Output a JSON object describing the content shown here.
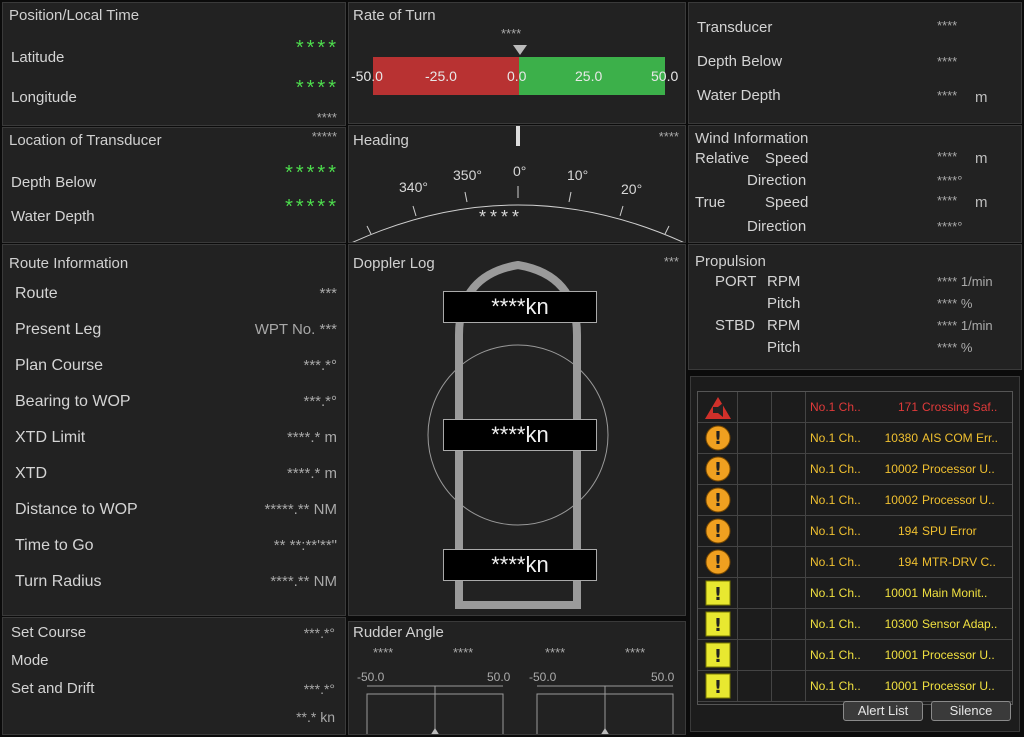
{
  "position": {
    "title": "Position/Local Time",
    "lat_label": "Latitude",
    "lat_value": "****",
    "lon_label": "Longitude",
    "lon_value": "****",
    "time_value": "****"
  },
  "transducer_loc": {
    "title": "Location of Transducer",
    "title_value": "*****",
    "depth_below_label": "Depth Below",
    "depth_below_value": "*****",
    "water_depth_label": "Water Depth",
    "water_depth_value": "*****"
  },
  "rate_of_turn": {
    "title": "Rate of Turn",
    "value": "****",
    "scale": [
      "-50.0",
      "-25.0",
      "0.0",
      "25.0",
      "50.0"
    ]
  },
  "heading": {
    "title": "Heading",
    "value_top": "****",
    "value_center": "****",
    "scale": [
      "340°",
      "350°",
      "0°",
      "10°",
      "20°"
    ]
  },
  "transducer": {
    "title": "Transducer",
    "title_value": "****",
    "depth_below_label": "Depth Below",
    "depth_below_value": "****",
    "water_depth_label": "Water Depth",
    "water_depth_value": "****",
    "water_depth_unit": "m"
  },
  "wind": {
    "title": "Wind Information",
    "relative_label": "Relative",
    "true_label": "True",
    "speed_label": "Speed",
    "direction_label": "Direction",
    "rel_speed": "****",
    "rel_speed_unit": "m",
    "rel_dir": "****°",
    "true_speed": "****",
    "true_speed_unit": "m",
    "true_dir": "****°"
  },
  "route": {
    "title": "Route Information",
    "rows": [
      {
        "label": "Route",
        "value": "***"
      },
      {
        "label": "Present Leg",
        "value": "WPT No. ***"
      },
      {
        "label": "Plan Course",
        "value": "***.*°"
      },
      {
        "label": "Bearing to WOP",
        "value": "***.*°"
      },
      {
        "label": "XTD Limit",
        "value": "****.* m"
      },
      {
        "label": "XTD",
        "value": "****.* m"
      },
      {
        "label": "Distance to WOP",
        "value": "*****.** NM"
      },
      {
        "label": "Time to Go",
        "value": "** **:**'**\""
      },
      {
        "label": "Turn Radius",
        "value": "****.** NM"
      }
    ],
    "set_course_label": "Set Course",
    "set_course_value": "***.*°",
    "mode_label": "Mode",
    "set_drift_label": "Set and Drift",
    "set_drift_value1": "***.*°",
    "set_drift_value2": "**.* kn"
  },
  "doppler": {
    "title": "Doppler Log",
    "title_value": "***",
    "top": "****kn",
    "mid": "****kn",
    "bottom": "****kn"
  },
  "rudder": {
    "title": "Rudder Angle",
    "v1": "****",
    "v2": "****",
    "v3": "****",
    "v4": "****",
    "left_min": "-50.0",
    "left_max": "50.0",
    "right_min": "-50.0",
    "right_max": "50.0"
  },
  "propulsion": {
    "title": "Propulsion",
    "port_label": "PORT",
    "stbd_label": "STBD",
    "rpm_label": "RPM",
    "pitch_label": "Pitch",
    "port_rpm": "**** 1/min",
    "port_pitch": "**** %",
    "stbd_rpm": "**** 1/min",
    "stbd_pitch": "**** %"
  },
  "alerts": {
    "rows": [
      {
        "icon": "red-triangle",
        "source": "No.1 Ch..",
        "id": "171",
        "msg": "Crossing Saf..",
        "color": "#e03a3a"
      },
      {
        "icon": "orange-circle",
        "source": "No.1 Ch..",
        "id": "10380",
        "msg": "AIS COM Err..",
        "color": "#f0c030"
      },
      {
        "icon": "orange-circle",
        "source": "No.1 Ch..",
        "id": "10002",
        "msg": "Processor U..",
        "color": "#f0c030"
      },
      {
        "icon": "orange-circle",
        "source": "No.1 Ch..",
        "id": "10002",
        "msg": "Processor U..",
        "color": "#f0c030"
      },
      {
        "icon": "orange-circle",
        "source": "No.1 Ch..",
        "id": "194",
        "msg": "SPU Error",
        "color": "#f0c030"
      },
      {
        "icon": "orange-circle",
        "source": "No.1 Ch..",
        "id": "194",
        "msg": "MTR-DRV C..",
        "color": "#f0c030"
      },
      {
        "icon": "yellow-square",
        "source": "No.1 Ch..",
        "id": "10001",
        "msg": "Main Monit..",
        "color": "#f0e040"
      },
      {
        "icon": "yellow-square",
        "source": "No.1 Ch..",
        "id": "10300",
        "msg": "Sensor Adap..",
        "color": "#f0e040"
      },
      {
        "icon": "yellow-square",
        "source": "No.1 Ch..",
        "id": "10001",
        "msg": "Processor U..",
        "color": "#f0e040"
      },
      {
        "icon": "yellow-square",
        "source": "No.1 Ch..",
        "id": "10001",
        "msg": "Processor U..",
        "color": "#f0e040"
      }
    ],
    "alert_list_label": "Alert List",
    "silence_label": "Silence"
  }
}
